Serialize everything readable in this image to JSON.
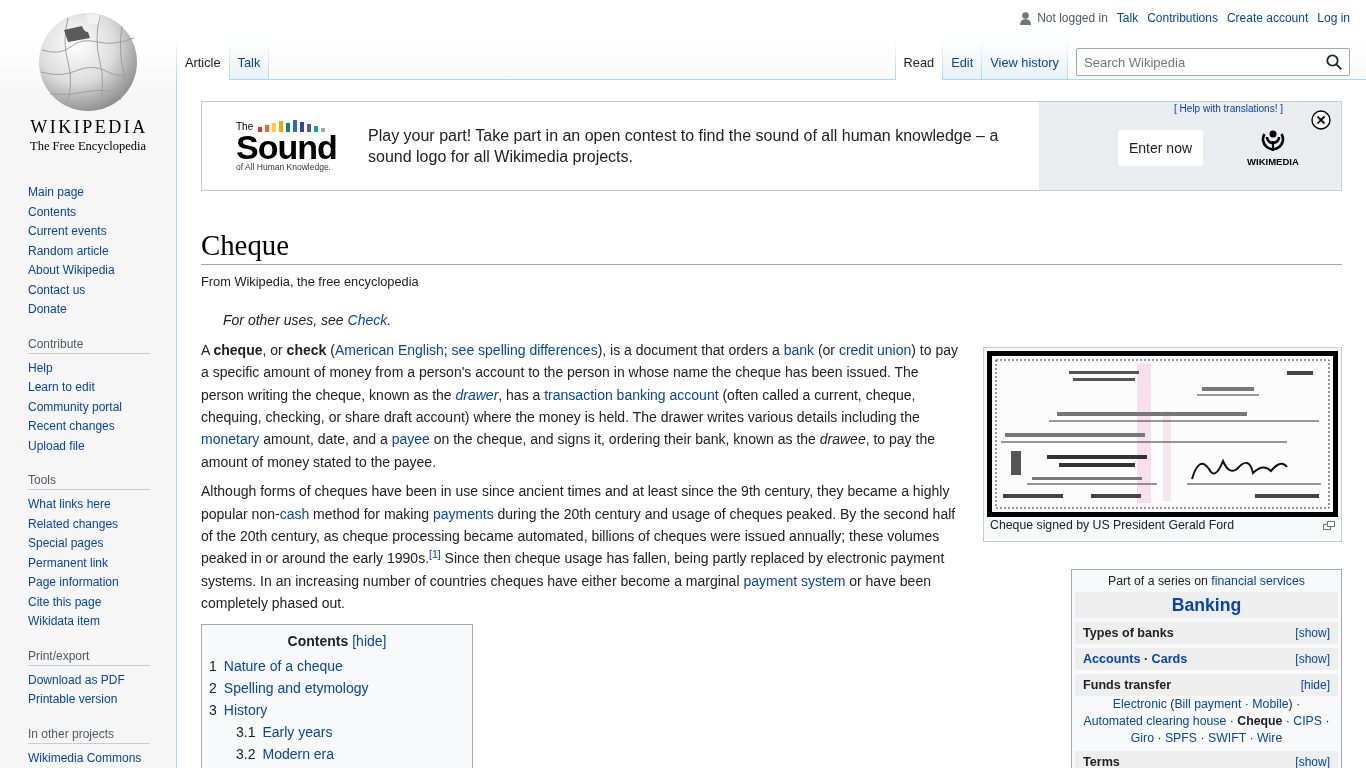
{
  "personal": {
    "status": "Not logged in",
    "links": [
      "Talk",
      "Contributions",
      "Create account",
      "Log in"
    ]
  },
  "logo": {
    "wordmark": "WIKIPEDIA",
    "tagline": "The Free Encyclopedia"
  },
  "sidebar": {
    "navigation": [
      "Main page",
      "Contents",
      "Current events",
      "Random article",
      "About Wikipedia",
      "Contact us",
      "Donate"
    ],
    "sections": [
      {
        "heading": "Contribute",
        "items": [
          "Help",
          "Learn to edit",
          "Community portal",
          "Recent changes",
          "Upload file"
        ]
      },
      {
        "heading": "Tools",
        "items": [
          "What links here",
          "Related changes",
          "Special pages",
          "Permanent link",
          "Page information",
          "Cite this page",
          "Wikidata item"
        ]
      },
      {
        "heading": "Print/export",
        "items": [
          "Download as PDF",
          "Printable version"
        ]
      },
      {
        "heading": "In other projects",
        "items": [
          "Wikimedia Commons"
        ]
      }
    ]
  },
  "namespace_tabs": [
    {
      "label": "Article",
      "selected": true
    },
    {
      "label": "Talk",
      "selected": false
    }
  ],
  "view_tabs": [
    {
      "label": "Read",
      "selected": true
    },
    {
      "label": "Edit",
      "selected": false
    },
    {
      "label": "View history",
      "selected": false
    }
  ],
  "search": {
    "placeholder": "Search Wikipedia"
  },
  "banner": {
    "logo": {
      "prefix": "The",
      "name": "Sound",
      "tagline": "of All Human Knowledge."
    },
    "message": "Play your part! Take part in an open contest to find the sound of all human knowledge – a sound logo for all Wikimedia projects.",
    "help_link": "[ Help with translations! ]",
    "button": "Enter now",
    "brand": "WIKIMEDIA"
  },
  "article": {
    "title": "Cheque",
    "subtitle": "From Wikipedia, the free encyclopedia",
    "hatnote": [
      {
        "kind": "text",
        "text": "For other uses, see "
      },
      {
        "kind": "link",
        "text": "Check"
      },
      {
        "kind": "text",
        "text": "."
      }
    ],
    "figure": {
      "caption": "Cheque signed by US President Gerald Ford"
    },
    "infobox": {
      "intro": [
        {
          "kind": "text",
          "text": "Part of a series on "
        },
        {
          "kind": "link",
          "text": "financial services"
        }
      ],
      "title": "Banking",
      "sections": [
        {
          "heading": [
            {
              "kind": "text",
              "text": "Types of banks"
            }
          ],
          "toggle": "[show]"
        },
        {
          "heading": [
            {
              "kind": "link",
              "text": "Accounts"
            },
            {
              "kind": "text",
              "text": " · "
            },
            {
              "kind": "link",
              "text": "Cards"
            }
          ],
          "toggle": "[show]"
        },
        {
          "heading": [
            {
              "kind": "text",
              "text": "Funds transfer"
            }
          ],
          "toggle": "[hide]",
          "content": [
            {
              "kind": "link",
              "text": "Electronic"
            },
            {
              "kind": "text",
              "text": " ("
            },
            {
              "kind": "link",
              "text": "Bill payment"
            },
            {
              "kind": "text",
              "text": " · "
            },
            {
              "kind": "link",
              "text": "Mobile"
            },
            {
              "kind": "text",
              "text": ") · "
            },
            {
              "kind": "link",
              "text": "Automated clearing house"
            },
            {
              "kind": "text",
              "text": " · **Cheque** · "
            },
            {
              "kind": "link",
              "text": "CIPS"
            },
            {
              "kind": "text",
              "text": " · "
            },
            {
              "kind": "link",
              "text": "Giro"
            },
            {
              "kind": "text",
              "text": " · "
            },
            {
              "kind": "link",
              "text": "SPFS"
            },
            {
              "kind": "text",
              "text": " · "
            },
            {
              "kind": "link",
              "text": "SWIFT"
            },
            {
              "kind": "text",
              "text": " · "
            },
            {
              "kind": "link",
              "text": "Wire"
            }
          ]
        },
        {
          "heading": [
            {
              "kind": "text",
              "text": "Terms"
            }
          ],
          "toggle": "[show]"
        }
      ]
    },
    "paragraphs": [
      [
        {
          "kind": "text",
          "text": "A **cheque**, or **check** ("
        },
        {
          "kind": "link",
          "text": "American English"
        },
        {
          "kind": "text",
          "text": "; "
        },
        {
          "kind": "link",
          "text": "see spelling differences"
        },
        {
          "kind": "text",
          "text": "), is a document that orders a "
        },
        {
          "kind": "link",
          "text": "bank"
        },
        {
          "kind": "text",
          "text": " (or "
        },
        {
          "kind": "link",
          "text": "credit union"
        },
        {
          "kind": "text",
          "text": ") to pay a specific amount of money from a person's account to the person in whose name the cheque has been issued. The person writing the cheque, known as the "
        },
        {
          "kind": "link",
          "text": "*drawer*"
        },
        {
          "kind": "text",
          "text": ", has a "
        },
        {
          "kind": "link",
          "text": "transaction banking account"
        },
        {
          "kind": "text",
          "text": " (often called a current, cheque, chequing, checking, or share draft account) where the money is held. The drawer writes various details including the "
        },
        {
          "kind": "link",
          "text": "monetary"
        },
        {
          "kind": "text",
          "text": " amount, date, and a "
        },
        {
          "kind": "link",
          "text": "payee"
        },
        {
          "kind": "text",
          "text": " on the cheque, and signs it, ordering their bank, known as the *drawee*, to pay the amount of money stated to the payee."
        }
      ],
      [
        {
          "kind": "text",
          "text": "Although forms of cheques have been in use since ancient times and at least since the 9th century, they became a highly popular non-"
        },
        {
          "kind": "link",
          "text": "cash"
        },
        {
          "kind": "text",
          "text": " method for making "
        },
        {
          "kind": "link",
          "text": "payments"
        },
        {
          "kind": "text",
          "text": " during the 20th century and usage of cheques peaked. By the second half of the 20th century, as cheque processing became automated, billions of cheques were issued annually; these volumes peaked in or around the early 1990s."
        },
        {
          "kind": "link",
          "text": "$^{[1]}$"
        },
        {
          "kind": "text",
          "text": " Since then cheque usage has fallen, being partly replaced by electronic payment systems. In an increasing number of countries cheques have either become a marginal "
        },
        {
          "kind": "link",
          "text": "payment system"
        },
        {
          "kind": "text",
          "text": " or have been completely phased out."
        }
      ]
    ],
    "contents": {
      "title": "Contents",
      "toggle": "[hide]",
      "items": [
        {
          "number": "1",
          "label": "Nature of a cheque"
        },
        {
          "number": "2",
          "label": "Spelling and etymology"
        },
        {
          "number": "3",
          "label": "History",
          "children": [
            {
              "number": "3.1",
              "label": "Early years"
            },
            {
              "number": "3.2",
              "label": "Modern era"
            }
          ]
        }
      ]
    }
  }
}
